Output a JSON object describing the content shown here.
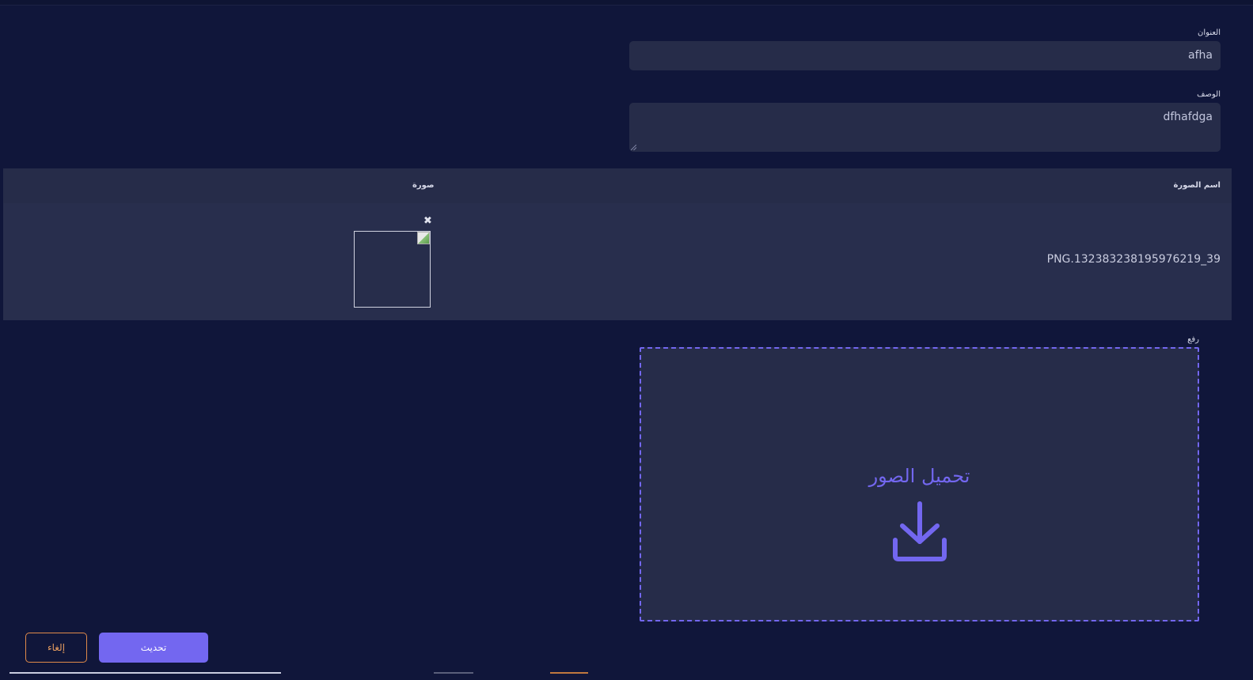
{
  "form": {
    "title_label": "العنوان",
    "title_value": "afha",
    "description_label": "الوصف",
    "description_value": "dfhafdga"
  },
  "images_table": {
    "columns": [
      "اسم الصورة",
      "صورة"
    ],
    "rows": [
      {
        "name": "PNG.132383238195976219_39",
        "remove_icon": "close-icon"
      }
    ]
  },
  "upload": {
    "label": "رفع",
    "dropzone_text": "تحميل الصور",
    "icon": "download-icon"
  },
  "actions": {
    "update_label": "تحديث",
    "cancel_label": "إلغاء"
  },
  "colors": {
    "background": "#10163a",
    "surface": "#262c49",
    "accent": "#7367f0",
    "cancel_border": "#e08a4a"
  }
}
